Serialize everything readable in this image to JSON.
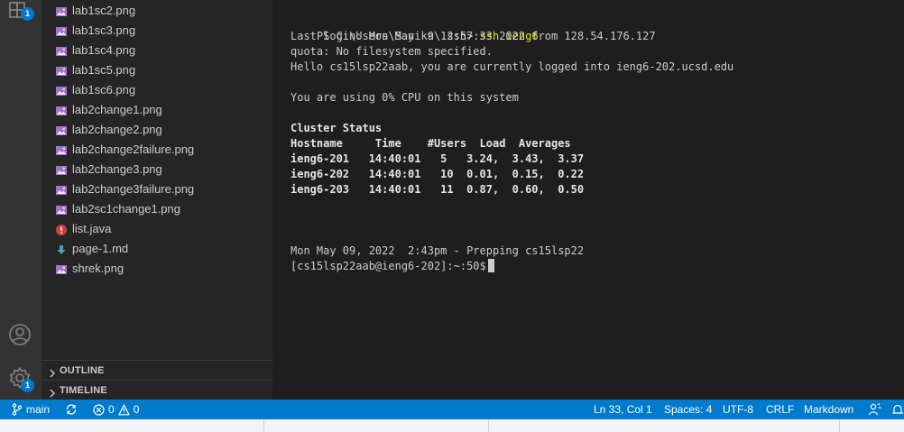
{
  "activity_bar": {
    "extensions_badge": "1",
    "settings_badge": "1"
  },
  "explorer": {
    "files": [
      {
        "name": "lab1sc2.png",
        "type": "image"
      },
      {
        "name": "lab1sc3.png",
        "type": "image"
      },
      {
        "name": "lab1sc4.png",
        "type": "image"
      },
      {
        "name": "lab1sc5.png",
        "type": "image"
      },
      {
        "name": "lab1sc6.png",
        "type": "image"
      },
      {
        "name": "lab2change1.png",
        "type": "image"
      },
      {
        "name": "lab2change2.png",
        "type": "image"
      },
      {
        "name": "lab2change2failure.png",
        "type": "image"
      },
      {
        "name": "lab2change3.png",
        "type": "image"
      },
      {
        "name": "lab2change3failure.png",
        "type": "image"
      },
      {
        "name": "lab2sc1change1.png",
        "type": "image"
      },
      {
        "name": "list.java",
        "type": "java"
      },
      {
        "name": "page-1.md",
        "type": "markdown"
      },
      {
        "name": "shrek.png",
        "type": "image"
      }
    ],
    "outline_label": "OUTLINE",
    "timeline_label": "TIMELINE"
  },
  "terminal": {
    "prompt": "PS C:\\Users\\Sanika\\.ssh>",
    "command": "ssh ieng6",
    "lines": [
      "Last login: Mon May  9 12:57:33 2022 from 128.54.176.127",
      "quota: No filesystem specified.",
      "Hello cs15lsp22aab, you are currently logged into ieng6-202.ucsd.edu",
      "",
      "You are using 0% CPU on this system",
      "",
      "Cluster Status",
      "Hostname     Time    #Users  Load  Averages",
      "ieng6-201   14:40:01   5   3.24,  3.43,  3.37",
      "ieng6-202   14:40:01   10  0.01,  0.15,  0.22",
      "ieng6-203   14:40:01   11  0.87,  0.60,  0.50",
      "",
      "",
      "",
      "Mon May 09, 2022  2:43pm - Prepping cs15lsp22",
      "[cs15lsp22aab@ieng6-202]:~:50$"
    ],
    "bold_lines": [
      6,
      7,
      8,
      9,
      10
    ]
  },
  "status_bar": {
    "branch": "main",
    "errors": "0",
    "warnings": "0",
    "position": "Ln 33, Col 1",
    "spaces": "Spaces: 4",
    "encoding": "UTF-8",
    "eol": "CRLF",
    "language": "Markdown"
  },
  "colors": {
    "activity_bar": "#333333",
    "sidebar": "#252526",
    "terminal_bg": "#1e1e1e",
    "status_bar": "#007acc",
    "command_yellow": "#e5e510"
  }
}
